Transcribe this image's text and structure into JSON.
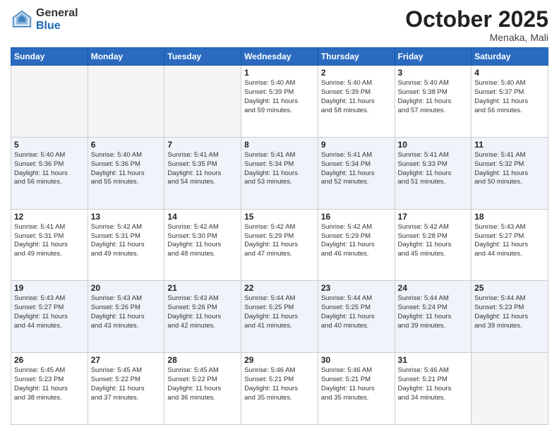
{
  "header": {
    "logo_general": "General",
    "logo_blue": "Blue",
    "month": "October 2025",
    "location": "Menaka, Mali"
  },
  "days_of_week": [
    "Sunday",
    "Monday",
    "Tuesday",
    "Wednesday",
    "Thursday",
    "Friday",
    "Saturday"
  ],
  "weeks": [
    [
      {
        "day": "",
        "info": ""
      },
      {
        "day": "",
        "info": ""
      },
      {
        "day": "",
        "info": ""
      },
      {
        "day": "1",
        "info": "Sunrise: 5:40 AM\nSunset: 5:39 PM\nDaylight: 11 hours\nand 59 minutes."
      },
      {
        "day": "2",
        "info": "Sunrise: 5:40 AM\nSunset: 5:39 PM\nDaylight: 11 hours\nand 58 minutes."
      },
      {
        "day": "3",
        "info": "Sunrise: 5:40 AM\nSunset: 5:38 PM\nDaylight: 11 hours\nand 57 minutes."
      },
      {
        "day": "4",
        "info": "Sunrise: 5:40 AM\nSunset: 5:37 PM\nDaylight: 11 hours\nand 56 minutes."
      }
    ],
    [
      {
        "day": "5",
        "info": "Sunrise: 5:40 AM\nSunset: 5:36 PM\nDaylight: 11 hours\nand 56 minutes."
      },
      {
        "day": "6",
        "info": "Sunrise: 5:40 AM\nSunset: 5:36 PM\nDaylight: 11 hours\nand 55 minutes."
      },
      {
        "day": "7",
        "info": "Sunrise: 5:41 AM\nSunset: 5:35 PM\nDaylight: 11 hours\nand 54 minutes."
      },
      {
        "day": "8",
        "info": "Sunrise: 5:41 AM\nSunset: 5:34 PM\nDaylight: 11 hours\nand 53 minutes."
      },
      {
        "day": "9",
        "info": "Sunrise: 5:41 AM\nSunset: 5:34 PM\nDaylight: 11 hours\nand 52 minutes."
      },
      {
        "day": "10",
        "info": "Sunrise: 5:41 AM\nSunset: 5:33 PM\nDaylight: 11 hours\nand 51 minutes."
      },
      {
        "day": "11",
        "info": "Sunrise: 5:41 AM\nSunset: 5:32 PM\nDaylight: 11 hours\nand 50 minutes."
      }
    ],
    [
      {
        "day": "12",
        "info": "Sunrise: 5:41 AM\nSunset: 5:31 PM\nDaylight: 11 hours\nand 49 minutes."
      },
      {
        "day": "13",
        "info": "Sunrise: 5:42 AM\nSunset: 5:31 PM\nDaylight: 11 hours\nand 49 minutes."
      },
      {
        "day": "14",
        "info": "Sunrise: 5:42 AM\nSunset: 5:30 PM\nDaylight: 11 hours\nand 48 minutes."
      },
      {
        "day": "15",
        "info": "Sunrise: 5:42 AM\nSunset: 5:29 PM\nDaylight: 11 hours\nand 47 minutes."
      },
      {
        "day": "16",
        "info": "Sunrise: 5:42 AM\nSunset: 5:29 PM\nDaylight: 11 hours\nand 46 minutes."
      },
      {
        "day": "17",
        "info": "Sunrise: 5:42 AM\nSunset: 5:28 PM\nDaylight: 11 hours\nand 45 minutes."
      },
      {
        "day": "18",
        "info": "Sunrise: 5:43 AM\nSunset: 5:27 PM\nDaylight: 11 hours\nand 44 minutes."
      }
    ],
    [
      {
        "day": "19",
        "info": "Sunrise: 5:43 AM\nSunset: 5:27 PM\nDaylight: 11 hours\nand 44 minutes."
      },
      {
        "day": "20",
        "info": "Sunrise: 5:43 AM\nSunset: 5:26 PM\nDaylight: 11 hours\nand 43 minutes."
      },
      {
        "day": "21",
        "info": "Sunrise: 5:43 AM\nSunset: 5:26 PM\nDaylight: 11 hours\nand 42 minutes."
      },
      {
        "day": "22",
        "info": "Sunrise: 5:44 AM\nSunset: 5:25 PM\nDaylight: 11 hours\nand 41 minutes."
      },
      {
        "day": "23",
        "info": "Sunrise: 5:44 AM\nSunset: 5:25 PM\nDaylight: 11 hours\nand 40 minutes."
      },
      {
        "day": "24",
        "info": "Sunrise: 5:44 AM\nSunset: 5:24 PM\nDaylight: 11 hours\nand 39 minutes."
      },
      {
        "day": "25",
        "info": "Sunrise: 5:44 AM\nSunset: 5:23 PM\nDaylight: 11 hours\nand 39 minutes."
      }
    ],
    [
      {
        "day": "26",
        "info": "Sunrise: 5:45 AM\nSunset: 5:23 PM\nDaylight: 11 hours\nand 38 minutes."
      },
      {
        "day": "27",
        "info": "Sunrise: 5:45 AM\nSunset: 5:22 PM\nDaylight: 11 hours\nand 37 minutes."
      },
      {
        "day": "28",
        "info": "Sunrise: 5:45 AM\nSunset: 5:22 PM\nDaylight: 11 hours\nand 36 minutes."
      },
      {
        "day": "29",
        "info": "Sunrise: 5:46 AM\nSunset: 5:21 PM\nDaylight: 11 hours\nand 35 minutes."
      },
      {
        "day": "30",
        "info": "Sunrise: 5:46 AM\nSunset: 5:21 PM\nDaylight: 11 hours\nand 35 minutes."
      },
      {
        "day": "31",
        "info": "Sunrise: 5:46 AM\nSunset: 5:21 PM\nDaylight: 11 hours\nand 34 minutes."
      },
      {
        "day": "",
        "info": ""
      }
    ]
  ]
}
